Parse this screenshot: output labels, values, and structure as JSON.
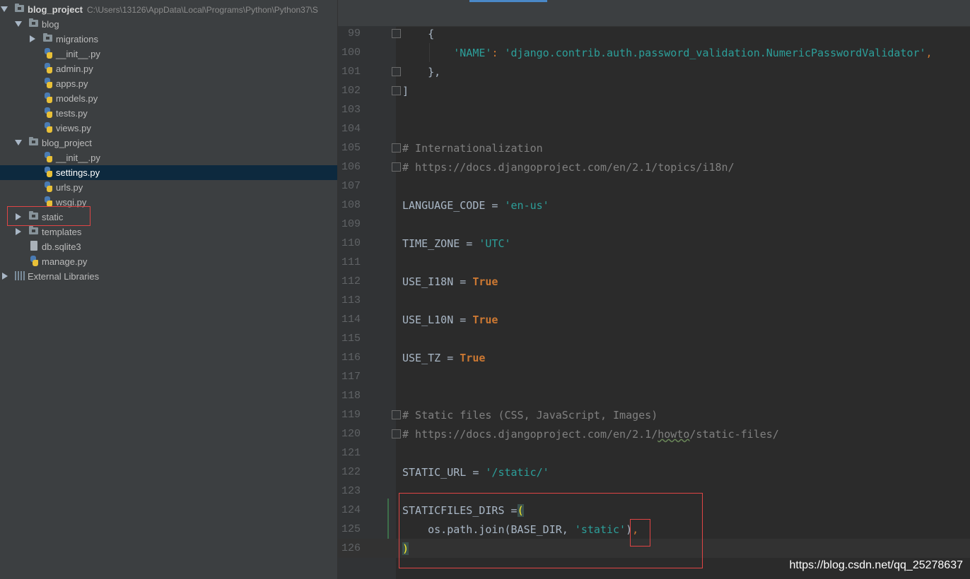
{
  "project_tree": {
    "root": {
      "name": "blog_project",
      "path": "C:\\Users\\13126\\AppData\\Local\\Programs\\Python\\Python37\\S"
    },
    "items": [
      {
        "label": "blog",
        "type": "folder",
        "expanded": true
      },
      {
        "label": "migrations",
        "type": "folder",
        "expanded": false
      },
      {
        "label": "__init__.py",
        "type": "python-file"
      },
      {
        "label": "admin.py",
        "type": "python-file"
      },
      {
        "label": "apps.py",
        "type": "python-file"
      },
      {
        "label": "models.py",
        "type": "python-file"
      },
      {
        "label": "tests.py",
        "type": "python-file"
      },
      {
        "label": "views.py",
        "type": "python-file"
      },
      {
        "label": "blog_project",
        "type": "folder",
        "expanded": true
      },
      {
        "label": "__init__.py",
        "type": "python-file"
      },
      {
        "label": "settings.py",
        "type": "python-file",
        "selected": true
      },
      {
        "label": "urls.py",
        "type": "python-file"
      },
      {
        "label": "wsgi.py",
        "type": "python-file"
      },
      {
        "label": "static",
        "type": "folder",
        "expanded": false,
        "highlighted": true
      },
      {
        "label": "templates",
        "type": "folder",
        "expanded": false
      },
      {
        "label": "db.sqlite3",
        "type": "database-file"
      },
      {
        "label": "manage.py",
        "type": "python-file"
      },
      {
        "label": "External Libraries",
        "type": "libraries",
        "expanded": false
      }
    ]
  },
  "editor": {
    "file": "settings.py",
    "lines": [
      {
        "n": "99",
        "text": "    {"
      },
      {
        "n": "100",
        "k": "        ",
        "s1": "'NAME'",
        "m": ": ",
        "s2": "'django.contrib.auth.password_validation.NumericPasswordValidator'",
        "end": ","
      },
      {
        "n": "101",
        "text": "    },"
      },
      {
        "n": "102",
        "text": "]"
      },
      {
        "n": "103",
        "text": ""
      },
      {
        "n": "104",
        "text": ""
      },
      {
        "n": "105",
        "comment": "# Internationalization"
      },
      {
        "n": "106",
        "comment": "# https://docs.djangoproject.com/en/2.1/topics/i18n/"
      },
      {
        "n": "107",
        "text": ""
      },
      {
        "n": "108",
        "name": "LANGUAGE_CODE = ",
        "str": "'en-us'"
      },
      {
        "n": "109",
        "text": ""
      },
      {
        "n": "110",
        "name": "TIME_ZONE = ",
        "str": "'UTC'"
      },
      {
        "n": "111",
        "text": ""
      },
      {
        "n": "112",
        "name": "USE_I18N = ",
        "kw": "True"
      },
      {
        "n": "113",
        "text": ""
      },
      {
        "n": "114",
        "name": "USE_L10N = ",
        "kw": "True"
      },
      {
        "n": "115",
        "text": ""
      },
      {
        "n": "116",
        "name": "USE_TZ = ",
        "kw": "True"
      },
      {
        "n": "117",
        "text": ""
      },
      {
        "n": "118",
        "text": ""
      },
      {
        "n": "119",
        "comment": "# Static files (CSS, JavaScript, Images)"
      },
      {
        "n": "120",
        "comment_a": "# https://docs.djangoproject.com/en/2.1/",
        "comment_b": "howto",
        "comment_c": "/static-files/"
      },
      {
        "n": "121",
        "text": ""
      },
      {
        "n": "122",
        "name": "STATIC_URL = ",
        "str": "'/static/'"
      },
      {
        "n": "123",
        "text": ""
      },
      {
        "n": "124",
        "name": "STATICFILES_DIRS =",
        "brace": "("
      },
      {
        "n": "125",
        "name": "    os.path.join(BASE_DIR, ",
        "str": "'static'",
        "tail": ")",
        "comma": ","
      },
      {
        "n": "126",
        "brace": ")"
      }
    ]
  },
  "watermark": "https://blog.csdn.net/qq_25278637",
  "colors": {
    "sidebar_bg": "#3c3f41",
    "editor_bg": "#2b2b2b",
    "selection": "#0d293e",
    "keyword": "#cc7832",
    "string": "#2c9f9a",
    "comment": "#808080",
    "annotation_box": "#e04545"
  }
}
